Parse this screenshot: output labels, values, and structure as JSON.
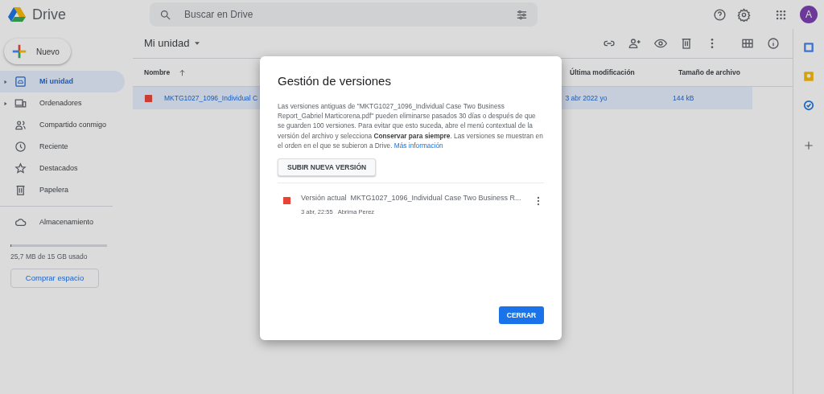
{
  "app": {
    "name": "Drive"
  },
  "search": {
    "placeholder": "Buscar en Drive"
  },
  "account": {
    "initial": "A"
  },
  "new_button": {
    "label": "Nuevo"
  },
  "sidebar": {
    "items": [
      {
        "label": "Mi unidad",
        "kind": "drive",
        "expandable": true,
        "selected": true
      },
      {
        "label": "Ordenadores",
        "kind": "computers",
        "expandable": true,
        "selected": false
      },
      {
        "label": "Compartido conmigo",
        "kind": "shared",
        "expandable": false,
        "selected": false
      },
      {
        "label": "Reciente",
        "kind": "recent",
        "expandable": false,
        "selected": false
      },
      {
        "label": "Destacados",
        "kind": "starred",
        "expandable": false,
        "selected": false
      },
      {
        "label": "Papelera",
        "kind": "trash",
        "expandable": false,
        "selected": false
      }
    ],
    "storage": {
      "label": "Almacenamiento",
      "level": 0.002,
      "usage": "25,7 MB de 15 GB usado",
      "buy_button": "Comprar espacio"
    }
  },
  "location": {
    "title": "Mi unidad"
  },
  "table": {
    "columns": [
      {
        "label": "Nombre",
        "sorted": true
      },
      {
        "label": "Última modificación",
        "sorted": false
      },
      {
        "label": "Tamaño de archivo",
        "sorted": false
      }
    ],
    "rows": [
      {
        "selected": true,
        "name": "MKTG1027_1096_Individual C",
        "modified": "3 abr 2022 yo",
        "size": "144 kB"
      }
    ]
  },
  "dialog": {
    "title": "Gestión de versiones",
    "description": "Las versiones antiguas de \"MKTG1027_1096_Individual Case Two Business Report_Gabriel Marticorena.pdf\" pueden eliminarse pasados 30 días o después de que se guarden 100 versiones. Para evitar que esto suceda, abre el menú contextual de la versión del archivo y selecciona **Conservar para siempre**. Las versiones se muestran en el orden en el que se subieron a Drive.",
    "link": "Más información",
    "upload_button": "SUBIR NUEVA VERSIÓN",
    "versions": [
      {
        "label": "Versión actual",
        "file": "MKTG1027_1096_Individual Case Two Business R...",
        "date": "3 abr, 22:55",
        "author": "Abrima Perez"
      }
    ],
    "close_button": "CERRAR"
  }
}
